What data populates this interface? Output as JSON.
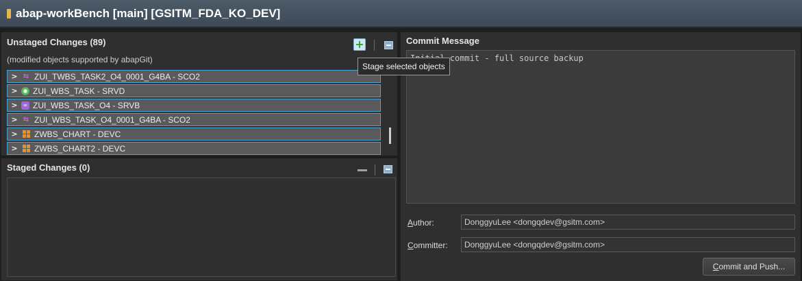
{
  "window": {
    "title": "abap-workBench [main] [GSITM_FDA_KO_DEV]"
  },
  "unstaged": {
    "title": "Unstaged Changes (89)",
    "subtitle": "(modified objects supported by abapGit)",
    "tooltip": "Stage selected objects",
    "items": [
      {
        "label": "ZUI_TWBS_TASK2_O4_0001_G4BA - SCO2",
        "icon": "sco2-icon"
      },
      {
        "label": "ZUI_WBS_TASK - SRVD",
        "icon": "srvd-icon"
      },
      {
        "label": "ZUI_WBS_TASK_O4 - SRVB",
        "icon": "srvb-icon"
      },
      {
        "label": "ZUI_WBS_TASK_O4_0001_G4BA - SCO2",
        "icon": "sco2-icon"
      },
      {
        "label": "ZWBS_CHART - DEVC",
        "icon": "package-icon"
      },
      {
        "label": "ZWBS_CHART2 - DEVC",
        "icon": "package-icon"
      }
    ]
  },
  "staged": {
    "title": "Staged Changes (0)"
  },
  "commit": {
    "title": "Commit Message",
    "message": "Initial commit - full source backup",
    "author_label_first": "A",
    "author_label_rest": "uthor:",
    "author_value": "DonggyuLee <dongqdev@gsitm.com>",
    "committer_label_first": "C",
    "committer_label_rest": "ommitter:",
    "committer_value": "DonggyuLee <dongqdev@gsitm.com>",
    "push_label_first": "C",
    "push_label_rest": "ommit and Push..."
  },
  "colors": {
    "accent": "#4aa3d8",
    "titlebar": "#46535f",
    "add_green": "#3e9b2a"
  }
}
